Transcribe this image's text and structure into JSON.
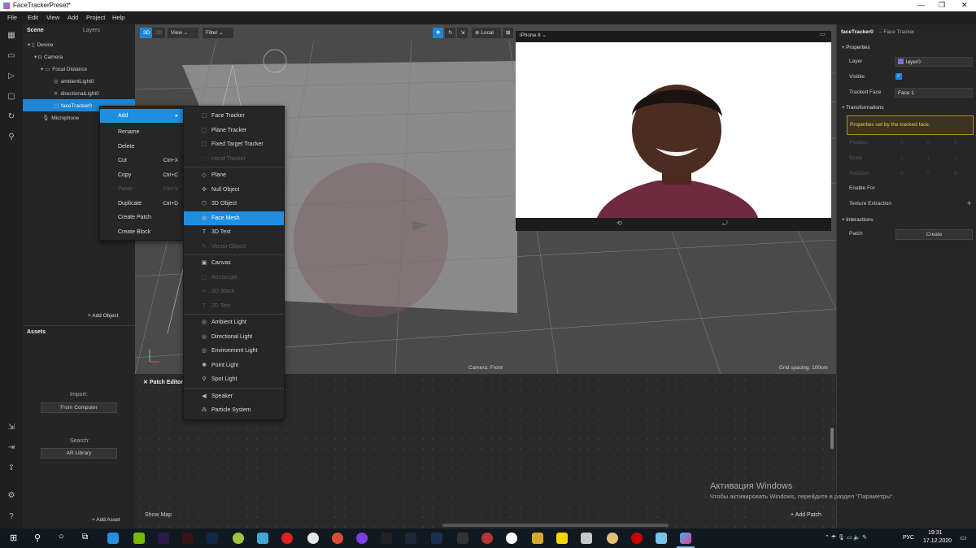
{
  "window": {
    "title": "FaceTrackerPreset*"
  },
  "menu": [
    "File",
    "Edit",
    "View",
    "Add",
    "Project",
    "Help"
  ],
  "scene": {
    "tabs": [
      "Scene",
      "Layers"
    ],
    "tree": [
      "Device",
      "Camera",
      "Focal Distance",
      "ambientLight0",
      "directionalLight0",
      "faceTracker0",
      "Microphone"
    ],
    "add_object": "+  Add Object"
  },
  "assets": {
    "title": "Assets",
    "import_label": "Import:",
    "import_button": "From Computer",
    "search_label": "Search:",
    "search_button": "AR Library",
    "add_asset": "+  Add Asset"
  },
  "viewport": {
    "mode_3d": "3D",
    "mode_2d": "2D",
    "view": "View",
    "filter": "Filter",
    "space": "Local",
    "device": "iPhone 8",
    "camera_label": "Camera: Front",
    "grid_label": "Grid spacing: 100cm"
  },
  "patch_editor": {
    "title": "Patch Editor",
    "show_map": "Show Map",
    "add_patch": "+  Add Patch"
  },
  "inspector": {
    "object_name": "faceTracker0",
    "object_type": "– Face Tracker",
    "properties": "Properties",
    "layer_label": "Layer",
    "layer_value": "layer0",
    "visible_label": "Visible",
    "tracked_face_label": "Tracked Face",
    "tracked_face_value": "Face 1",
    "transformations": "Transformations",
    "note": "Properties set by the tracked face.",
    "position": "Position",
    "scale": "Scale",
    "rotation": "Rotation",
    "position_values": [
      "0",
      "0",
      "0"
    ],
    "scale_values": [
      "1",
      "1",
      "1"
    ],
    "rotation_values": [
      "0",
      "0",
      "0"
    ],
    "enable_for": "Enable For",
    "texture_extraction": "Texture Extraction",
    "interactions": "Interactions",
    "patch_label": "Patch",
    "create": "Create",
    "layer_color": "#8a6ad0"
  },
  "context_menu": [
    {
      "label": "Add",
      "shortcut": "",
      "disabled": false,
      "submenu": true,
      "highlighted": true
    },
    {
      "label": "Rename",
      "shortcut": "",
      "disabled": false
    },
    {
      "label": "Delete",
      "shortcut": "",
      "disabled": false
    },
    {
      "label": "Cut",
      "shortcut": "Ctrl+X",
      "disabled": false
    },
    {
      "label": "Copy",
      "shortcut": "Ctrl+C",
      "disabled": false
    },
    {
      "label": "Paste",
      "shortcut": "Ctrl+V",
      "disabled": true
    },
    {
      "label": "Duplicate",
      "shortcut": "Ctrl+D",
      "disabled": false
    },
    {
      "label": "Create Patch",
      "shortcut": "",
      "disabled": false
    },
    {
      "label": "Create Block",
      "shortcut": "",
      "disabled": false
    }
  ],
  "submenu": [
    {
      "label": "Face Tracker",
      "icon": "face-tracker-icon",
      "glyph": "⬚",
      "disabled": false
    },
    {
      "label": "Plane Tracker",
      "icon": "plane-tracker-icon",
      "glyph": "⬚",
      "disabled": false
    },
    {
      "label": "Fixed Target Tracker",
      "icon": "target-tracker-icon",
      "glyph": "⬚",
      "disabled": false
    },
    {
      "label": "Hand Tracker",
      "icon": "hand-tracker-icon",
      "glyph": "⬚",
      "disabled": true
    },
    {
      "sep": true
    },
    {
      "label": "Plane",
      "icon": "plane-icon",
      "glyph": "◇",
      "disabled": false
    },
    {
      "label": "Null Object",
      "icon": "null-object-icon",
      "glyph": "✣",
      "disabled": false
    },
    {
      "label": "3D Object",
      "icon": "cube-icon",
      "glyph": "⬡",
      "disabled": false
    },
    {
      "label": "Face Mesh",
      "icon": "face-mesh-icon",
      "glyph": "◍",
      "disabled": false,
      "highlighted": true
    },
    {
      "label": "3D Text",
      "icon": "text-icon",
      "glyph": "T",
      "disabled": false
    },
    {
      "label": "Vector Object",
      "icon": "vector-icon",
      "glyph": "✎",
      "disabled": true
    },
    {
      "sep": true
    },
    {
      "label": "Canvas",
      "icon": "canvas-icon",
      "glyph": "▣",
      "disabled": false
    },
    {
      "label": "Rectangle",
      "icon": "rectangle-icon",
      "glyph": "▢",
      "disabled": true
    },
    {
      "label": "2D Stack",
      "icon": "stack-icon",
      "glyph": "≡",
      "disabled": true
    },
    {
      "label": "2D Text",
      "icon": "text-2d-icon",
      "glyph": "T",
      "disabled": true
    },
    {
      "sep": true
    },
    {
      "label": "Ambient Light",
      "icon": "ambient-light-icon",
      "glyph": "◎",
      "disabled": false
    },
    {
      "label": "Directional Light",
      "icon": "directional-light-icon",
      "glyph": "◎",
      "disabled": false
    },
    {
      "label": "Environment Light",
      "icon": "environment-light-icon",
      "glyph": "◎",
      "disabled": false
    },
    {
      "label": "Point Light",
      "icon": "point-light-icon",
      "glyph": "✺",
      "disabled": false
    },
    {
      "label": "Spot Light",
      "icon": "spot-light-icon",
      "glyph": "⚲",
      "disabled": false
    },
    {
      "sep": true
    },
    {
      "label": "Speaker",
      "icon": "speaker-icon",
      "glyph": "◀",
      "disabled": false
    },
    {
      "label": "Particle System",
      "icon": "particles-icon",
      "glyph": "⁂",
      "disabled": false
    }
  ],
  "watermark": {
    "line1": "Активация Windows",
    "line2": "Чтобы активировать Windows, перейдите в раздел \"Параметры\"."
  },
  "taskbar": {
    "lang": "РУС",
    "time": "19:31",
    "date": "17.12.2020"
  },
  "colors": {
    "accent": "#1e86d6",
    "highlight": "#1e8fe0"
  }
}
